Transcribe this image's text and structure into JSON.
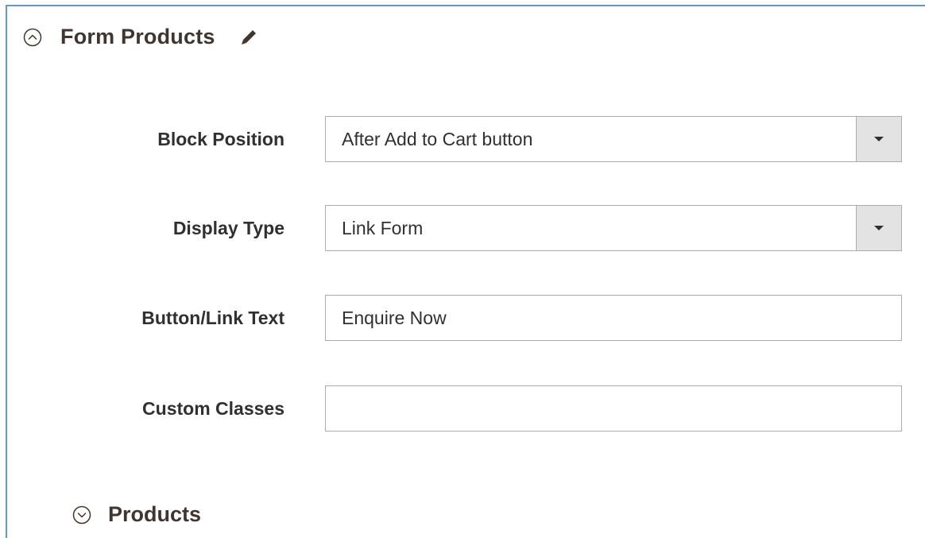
{
  "section": {
    "title": "Form Products",
    "toggle_icon": "collapse-chevron-up-circle-icon",
    "edit_icon": "pencil-icon"
  },
  "fields": {
    "block_position": {
      "label": "Block Position",
      "value": "After Add to Cart button",
      "type": "select"
    },
    "display_type": {
      "label": "Display Type",
      "value": "Link Form",
      "type": "select"
    },
    "button_link_text": {
      "label": "Button/Link Text",
      "value": "Enquire Now",
      "type": "text"
    },
    "custom_classes": {
      "label": "Custom Classes",
      "value": "",
      "type": "text"
    }
  },
  "subsection": {
    "title": "Products",
    "toggle_icon": "expand-chevron-down-circle-icon"
  },
  "colors": {
    "accent_border": "#5b9bd5",
    "heading_text": "#41362f",
    "select_button_bg": "#e3e3e3",
    "input_border": "#adadad"
  }
}
